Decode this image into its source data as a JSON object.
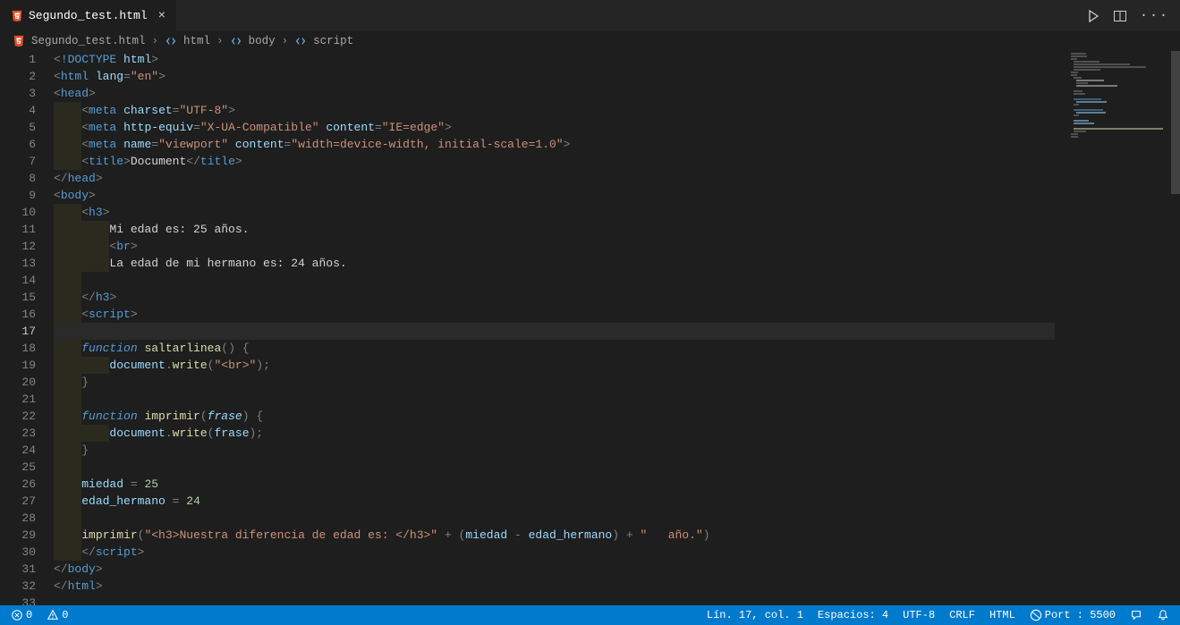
{
  "tab": {
    "filename": "Segundo_test.html"
  },
  "breadcrumb": {
    "file": "Segundo_test.html",
    "segments": [
      "html",
      "body",
      "script"
    ]
  },
  "editor": {
    "activeLine": 17,
    "lines": [
      {
        "n": 1,
        "tokens": [
          [
            "punct",
            "<"
          ],
          [
            "doctype",
            "!DOCTYPE"
          ],
          [
            "txt",
            " "
          ],
          [
            "attr",
            "html"
          ],
          [
            "punct",
            ">"
          ]
        ]
      },
      {
        "n": 2,
        "tokens": [
          [
            "punct",
            "<"
          ],
          [
            "tagname",
            "html"
          ],
          [
            "txt",
            " "
          ],
          [
            "attr",
            "lang"
          ],
          [
            "punct",
            "="
          ],
          [
            "str",
            "\"en\""
          ],
          [
            "punct",
            ">"
          ]
        ]
      },
      {
        "n": 3,
        "tokens": [
          [
            "punct",
            "<"
          ],
          [
            "tagname",
            "head"
          ],
          [
            "punct",
            ">"
          ]
        ]
      },
      {
        "n": 4,
        "indent": 1,
        "tokens": [
          [
            "punct",
            "<"
          ],
          [
            "tagname",
            "meta"
          ],
          [
            "txt",
            " "
          ],
          [
            "attr",
            "charset"
          ],
          [
            "punct",
            "="
          ],
          [
            "str",
            "\"UTF-8\""
          ],
          [
            "punct",
            ">"
          ]
        ]
      },
      {
        "n": 5,
        "indent": 1,
        "tokens": [
          [
            "punct",
            "<"
          ],
          [
            "tagname",
            "meta"
          ],
          [
            "txt",
            " "
          ],
          [
            "attr",
            "http-equiv"
          ],
          [
            "punct",
            "="
          ],
          [
            "str",
            "\"X-UA-Compatible\""
          ],
          [
            "txt",
            " "
          ],
          [
            "attr",
            "content"
          ],
          [
            "punct",
            "="
          ],
          [
            "str",
            "\"IE=edge\""
          ],
          [
            "punct",
            ">"
          ]
        ]
      },
      {
        "n": 6,
        "indent": 1,
        "tokens": [
          [
            "punct",
            "<"
          ],
          [
            "tagname",
            "meta"
          ],
          [
            "txt",
            " "
          ],
          [
            "attr",
            "name"
          ],
          [
            "punct",
            "="
          ],
          [
            "str",
            "\"viewport\""
          ],
          [
            "txt",
            " "
          ],
          [
            "attr",
            "content"
          ],
          [
            "punct",
            "="
          ],
          [
            "str",
            "\"width=device-width, initial-scale=1.0\""
          ],
          [
            "punct",
            ">"
          ]
        ]
      },
      {
        "n": 7,
        "indent": 1,
        "tokens": [
          [
            "punct",
            "<"
          ],
          [
            "tagname",
            "title"
          ],
          [
            "punct",
            ">"
          ],
          [
            "txt",
            "Document"
          ],
          [
            "punct",
            "</"
          ],
          [
            "tagname",
            "title"
          ],
          [
            "punct",
            ">"
          ]
        ]
      },
      {
        "n": 8,
        "tokens": [
          [
            "punct",
            "</"
          ],
          [
            "tagname",
            "head"
          ],
          [
            "punct",
            ">"
          ]
        ]
      },
      {
        "n": 9,
        "tokens": [
          [
            "punct",
            "<"
          ],
          [
            "tagname",
            "body"
          ],
          [
            "punct",
            ">"
          ]
        ]
      },
      {
        "n": 10,
        "indent": 1,
        "tokens": [
          [
            "punct",
            "<"
          ],
          [
            "tagname",
            "h3"
          ],
          [
            "punct",
            ">"
          ]
        ]
      },
      {
        "n": 11,
        "indent": 2,
        "tokens": [
          [
            "txt",
            "Mi edad es: 25 años."
          ]
        ]
      },
      {
        "n": 12,
        "indent": 2,
        "tokens": [
          [
            "punct",
            "<"
          ],
          [
            "tagname",
            "br"
          ],
          [
            "punct",
            ">"
          ]
        ]
      },
      {
        "n": 13,
        "indent": 2,
        "tokens": [
          [
            "txt",
            "La edad de mi hermano es: 24 años."
          ]
        ]
      },
      {
        "n": 14,
        "indent": 1,
        "tokens": []
      },
      {
        "n": 15,
        "indent": 1,
        "tokens": [
          [
            "punct",
            "</"
          ],
          [
            "tagname",
            "h3"
          ],
          [
            "punct",
            ">"
          ]
        ]
      },
      {
        "n": 16,
        "indent": 1,
        "tokens": [
          [
            "punct",
            "<"
          ],
          [
            "tagname",
            "script"
          ],
          [
            "punct",
            ">"
          ]
        ]
      },
      {
        "n": 17,
        "indent": 0,
        "tokens": [],
        "active": true
      },
      {
        "n": 18,
        "indent": 1,
        "tokens": [
          [
            "kw",
            "function"
          ],
          [
            "txt",
            " "
          ],
          [
            "fn",
            "saltarlinea"
          ],
          [
            "punct",
            "()"
          ],
          [
            "txt",
            " "
          ],
          [
            "punct",
            "{"
          ]
        ]
      },
      {
        "n": 19,
        "indent": 2,
        "tokens": [
          [
            "var",
            "document"
          ],
          [
            "punct",
            "."
          ],
          [
            "fn",
            "write"
          ],
          [
            "punct",
            "("
          ],
          [
            "str",
            "\"<br>\""
          ],
          [
            "punct",
            ");"
          ]
        ]
      },
      {
        "n": 20,
        "indent": 1,
        "tokens": [
          [
            "punct",
            "}"
          ]
        ]
      },
      {
        "n": 21,
        "indent": 1,
        "tokens": []
      },
      {
        "n": 22,
        "indent": 1,
        "tokens": [
          [
            "kw",
            "function"
          ],
          [
            "txt",
            " "
          ],
          [
            "fn",
            "imprimir"
          ],
          [
            "punct",
            "("
          ],
          [
            "param",
            "frase"
          ],
          [
            "punct",
            ")"
          ],
          [
            "txt",
            " "
          ],
          [
            "punct",
            "{"
          ]
        ]
      },
      {
        "n": 23,
        "indent": 2,
        "tokens": [
          [
            "var",
            "document"
          ],
          [
            "punct",
            "."
          ],
          [
            "fn",
            "write"
          ],
          [
            "punct",
            "("
          ],
          [
            "var",
            "frase"
          ],
          [
            "punct",
            ");"
          ]
        ]
      },
      {
        "n": 24,
        "indent": 1,
        "tokens": [
          [
            "punct",
            "}"
          ]
        ]
      },
      {
        "n": 25,
        "indent": 1,
        "tokens": []
      },
      {
        "n": 26,
        "indent": 1,
        "tokens": [
          [
            "var",
            "miedad"
          ],
          [
            "txt",
            " "
          ],
          [
            "punct",
            "="
          ],
          [
            "txt",
            " "
          ],
          [
            "num",
            "25"
          ]
        ]
      },
      {
        "n": 27,
        "indent": 1,
        "tokens": [
          [
            "var",
            "edad_hermano"
          ],
          [
            "txt",
            " "
          ],
          [
            "punct",
            "="
          ],
          [
            "txt",
            " "
          ],
          [
            "num",
            "24"
          ]
        ]
      },
      {
        "n": 28,
        "indent": 1,
        "tokens": []
      },
      {
        "n": 29,
        "indent": 1,
        "tokens": [
          [
            "fn",
            "imprimir"
          ],
          [
            "punct",
            "("
          ],
          [
            "str",
            "\"<h3>Nuestra diferencia de edad es: </h3>\""
          ],
          [
            "txt",
            " "
          ],
          [
            "punct",
            "+"
          ],
          [
            "txt",
            " "
          ],
          [
            "punct",
            "("
          ],
          [
            "var",
            "miedad"
          ],
          [
            "txt",
            " "
          ],
          [
            "punct",
            "-"
          ],
          [
            "txt",
            " "
          ],
          [
            "var",
            "edad_hermano"
          ],
          [
            "punct",
            ")"
          ],
          [
            "txt",
            " "
          ],
          [
            "punct",
            "+"
          ],
          [
            "txt",
            " "
          ],
          [
            "str",
            "\"   año.\""
          ],
          [
            "punct",
            ")"
          ]
        ]
      },
      {
        "n": 30,
        "indent": 1,
        "tokens": [
          [
            "punct",
            "</"
          ],
          [
            "tagname",
            "script"
          ],
          [
            "punct",
            ">"
          ]
        ]
      },
      {
        "n": 31,
        "tokens": [
          [
            "punct",
            "</"
          ],
          [
            "tagname",
            "body"
          ],
          [
            "punct",
            ">"
          ]
        ]
      },
      {
        "n": 32,
        "tokens": [
          [
            "punct",
            "</"
          ],
          [
            "tagname",
            "html"
          ],
          [
            "punct",
            ">"
          ]
        ]
      },
      {
        "n": 33,
        "tokens": []
      }
    ]
  },
  "statusbar": {
    "errors": "0",
    "warnings": "0",
    "position": "Lín. 17, col. 1",
    "spaces": "Espacios: 4",
    "encoding": "UTF-8",
    "eol": "CRLF",
    "language": "HTML",
    "port": "Port : 5500"
  }
}
